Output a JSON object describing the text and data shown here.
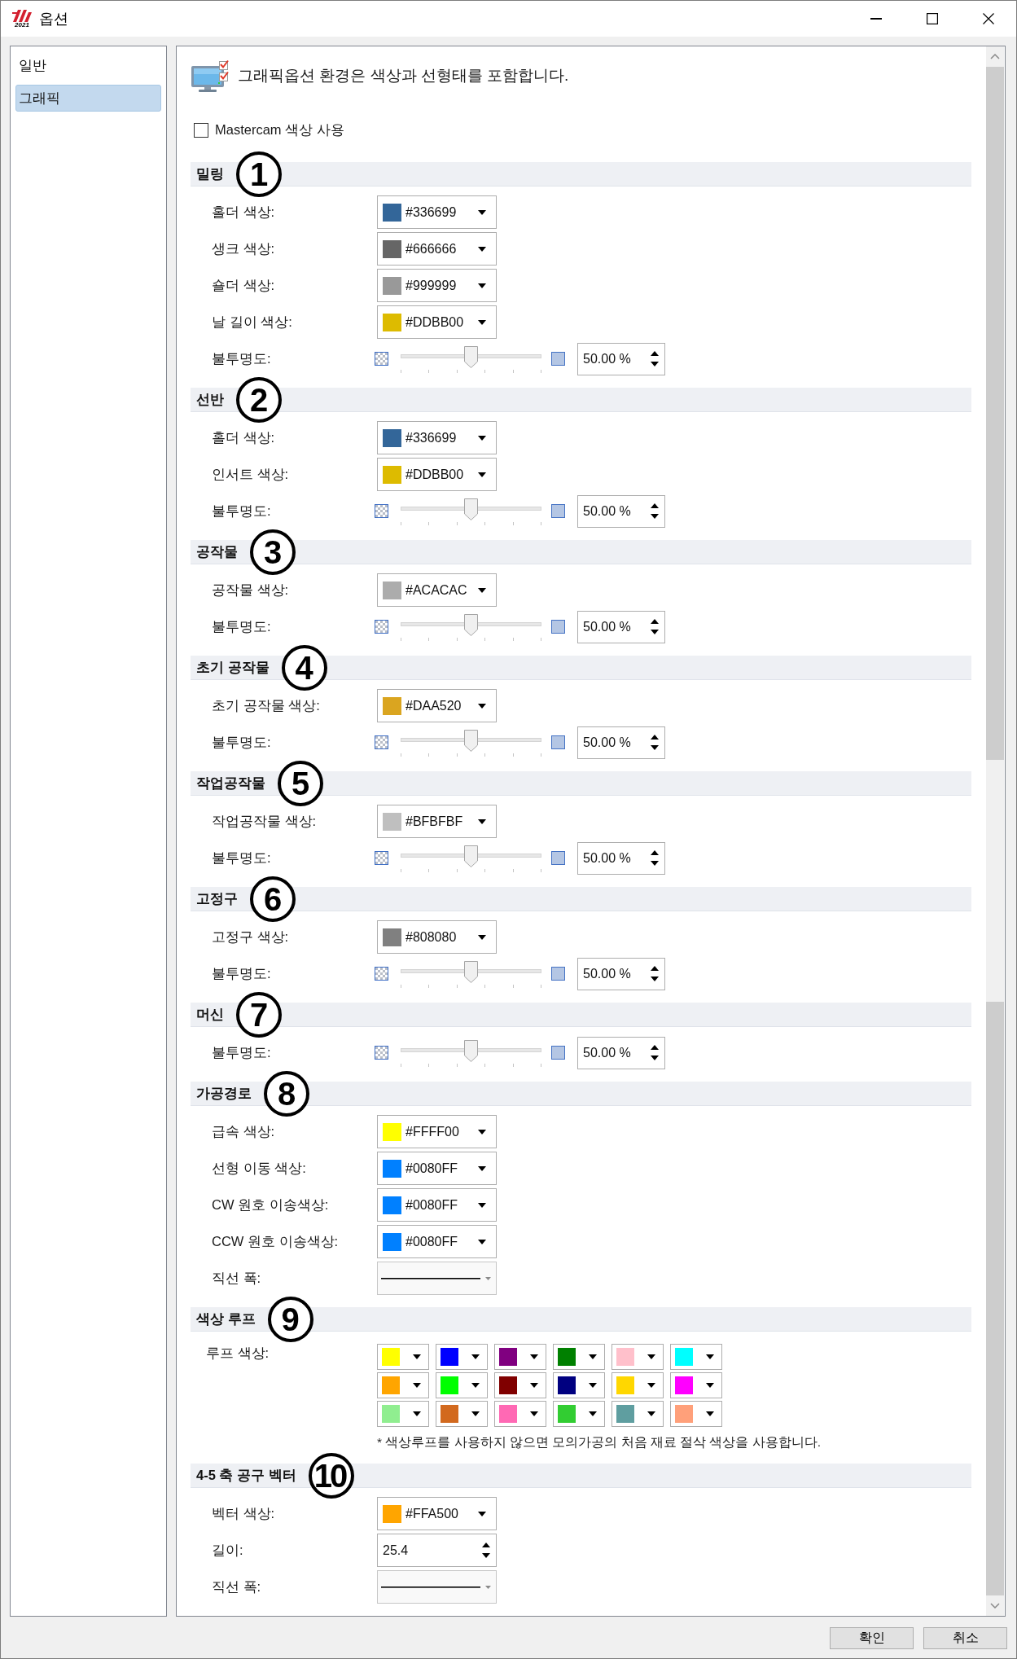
{
  "window": {
    "title": "옵션",
    "logo_text": "2021"
  },
  "sidebar": {
    "items": [
      {
        "label": "일반",
        "selected": false
      },
      {
        "label": "그래픽",
        "selected": true
      }
    ]
  },
  "header": {
    "text": "그래픽옵션 환경은 색상과 선형태를 포함합니다."
  },
  "mastercam_colors": {
    "label": "Mastercam 색상 사용",
    "checked": false
  },
  "sections": [
    {
      "title": "밀링",
      "marker": "1",
      "rows": [
        {
          "kind": "color",
          "label": "홀더 색상:",
          "value": "#336699",
          "color": "#336699"
        },
        {
          "kind": "color",
          "label": "생크 색상:",
          "value": "#666666",
          "color": "#666666"
        },
        {
          "kind": "color",
          "label": "숄더 색상:",
          "value": "#999999",
          "color": "#999999"
        },
        {
          "kind": "color",
          "label": "날 길이 색상:",
          "value": "#DDBB00",
          "color": "#ddbb00"
        },
        {
          "kind": "opacity",
          "label": "불투명도:",
          "level": 0.5,
          "reading": "50.00 %"
        }
      ]
    },
    {
      "title": "선반",
      "marker": "2",
      "rows": [
        {
          "kind": "color",
          "label": "홀더 색상:",
          "value": "#336699",
          "color": "#336699"
        },
        {
          "kind": "color",
          "label": "인서트 색상:",
          "value": "#DDBB00",
          "color": "#ddbb00"
        },
        {
          "kind": "opacity",
          "label": "불투명도:",
          "level": 0.5,
          "reading": "50.00 %"
        }
      ]
    },
    {
      "title": "공작물",
      "marker": "3",
      "rows": [
        {
          "kind": "color",
          "label": "공작물 색상:",
          "value": "#ACACAC",
          "color": "#acacac"
        },
        {
          "kind": "opacity",
          "label": "불투명도:",
          "level": 0.5,
          "reading": "50.00 %"
        }
      ]
    },
    {
      "title": "초기 공작물",
      "marker": "4",
      "rows": [
        {
          "kind": "color",
          "label": "초기 공작물 색상:",
          "value": "#DAA520",
          "color": "#daa520"
        },
        {
          "kind": "opacity",
          "label": "불투명도:",
          "level": 0.5,
          "reading": "50.00 %"
        }
      ]
    },
    {
      "title": "작업공작물",
      "marker": "5",
      "rows": [
        {
          "kind": "color",
          "label": "작업공작물 색상:",
          "value": "#BFBFBF",
          "color": "#bfbfbf"
        },
        {
          "kind": "opacity",
          "label": "불투명도:",
          "level": 0.5,
          "reading": "50.00 %"
        }
      ]
    },
    {
      "title": "고정구",
      "marker": "6",
      "rows": [
        {
          "kind": "color",
          "label": "고정구 색상:",
          "value": "#808080",
          "color": "#808080"
        },
        {
          "kind": "opacity",
          "label": "불투명도:",
          "level": 0.5,
          "reading": "50.00 %"
        }
      ]
    },
    {
      "title": "머신",
      "marker": "7",
      "rows": [
        {
          "kind": "opacity",
          "label": "불투명도:",
          "level": 0.5,
          "reading": "50.00 %"
        }
      ]
    },
    {
      "title": "가공경로",
      "marker": "8",
      "rows": [
        {
          "kind": "color",
          "label": "급속 색상:",
          "value": "#FFFF00",
          "color": "#ffff00"
        },
        {
          "kind": "color",
          "label": "선형 이동 색상:",
          "value": "#0080FF",
          "color": "#0080ff"
        },
        {
          "kind": "color",
          "label": "CW 원호 이송색상:",
          "value": "#0080FF",
          "color": "#0080ff"
        },
        {
          "kind": "color",
          "label": "CCW 원호 이송색상:",
          "value": "#0080FF",
          "color": "#0080ff"
        },
        {
          "kind": "line_width",
          "label": "직선 폭:"
        }
      ]
    },
    {
      "title": "색상 루프",
      "marker": "9",
      "rows": [
        {
          "kind": "color_grid",
          "label": "루프 색상:",
          "colors": [
            {
              "color": "#ffff00"
            },
            {
              "color": "#0000ff"
            },
            {
              "color": "#800080"
            },
            {
              "color": "#008000"
            },
            {
              "color": "#ffc0cb"
            },
            {
              "color": "#00ffff"
            },
            {
              "color": "#ffa500"
            },
            {
              "color": "#00ff00"
            },
            {
              "color": "#800000"
            },
            {
              "color": "#000080"
            },
            {
              "color": "#ffd700"
            },
            {
              "color": "#ff00ff"
            },
            {
              "color": "#90ee90"
            },
            {
              "color": "#d2691e"
            },
            {
              "color": "#ff69b4"
            },
            {
              "color": "#32cd32"
            },
            {
              "color": "#5f9ea0"
            },
            {
              "color": "#ffa07a"
            }
          ],
          "note": "* 색상루프를 사용하지 않으면 모의가공의 처음 재료 절삭 색상을 사용합니다."
        }
      ]
    },
    {
      "title": "4-5 축 공구 벡터",
      "marker": "10",
      "rows": [
        {
          "kind": "color",
          "label": "벡터 색상:",
          "value": "#FFA500",
          "color": "#ffa500"
        },
        {
          "kind": "number",
          "label": "길이:",
          "value": "25.4"
        },
        {
          "kind": "line_width",
          "label": "직선 폭:"
        }
      ]
    }
  ],
  "buttons": [
    {
      "label": "확인"
    },
    {
      "label": "취소"
    }
  ]
}
